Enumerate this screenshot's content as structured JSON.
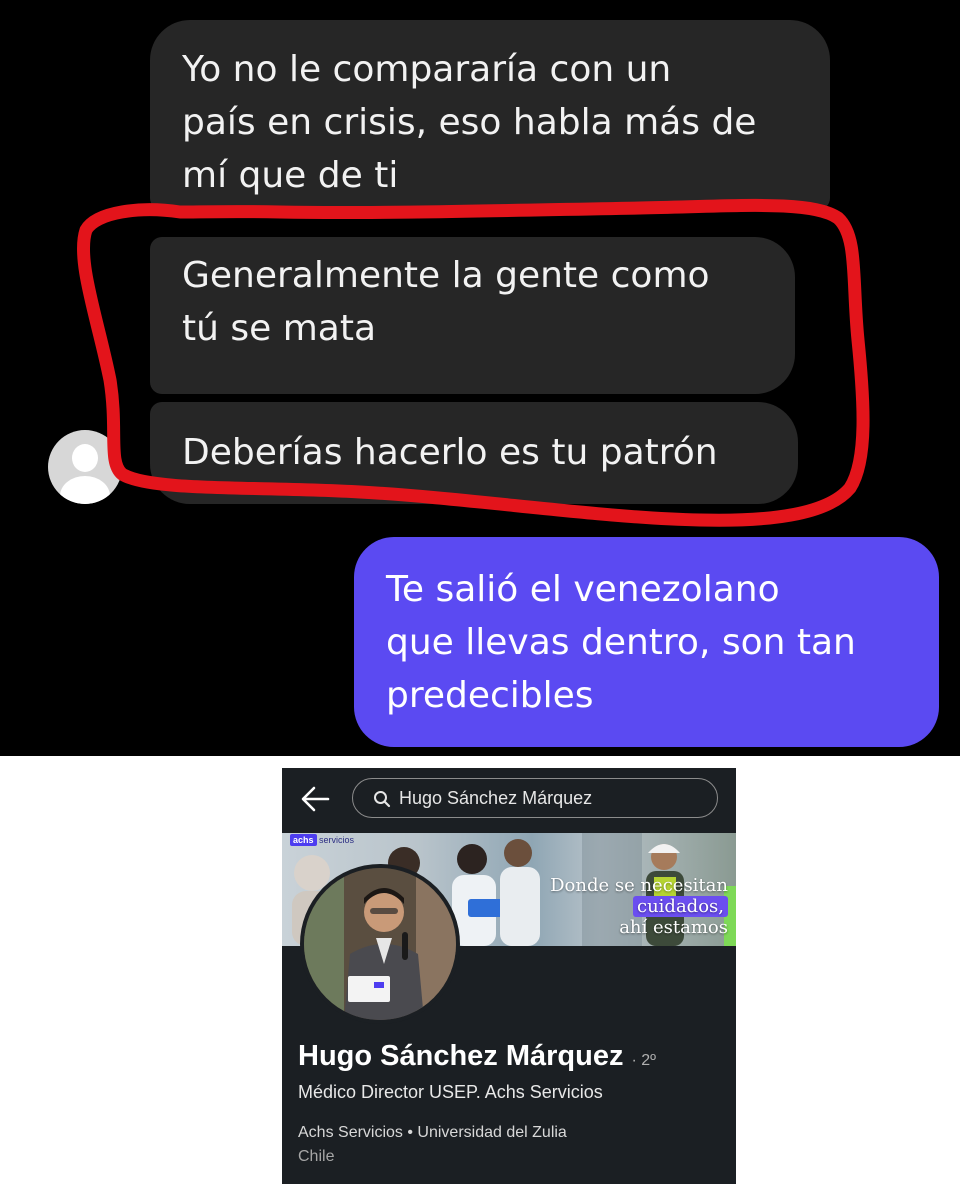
{
  "chat": {
    "messages_received": [
      "Yo no le compararía con un\npaís en crisis, eso habla más de\nmí que de ti",
      "Generalmente la gente como\ntú se mata",
      "Deberías hacerlo es tu patrón"
    ],
    "message_sent": "Te salió el venezolano\nque llevas dentro, son tan\npredecibles",
    "colors": {
      "background": "#000000",
      "received_bubble": "#262626",
      "sent_bubble": "#5b4af2",
      "highlight": "#e3141b"
    }
  },
  "profile": {
    "search": {
      "query": "Hugo Sánchez Márquez"
    },
    "banner": {
      "logo_brand": "achs",
      "logo_suffix": "servicios",
      "tagline_line1": "Donde se necesitan",
      "tagline_line2": "cuidados,",
      "tagline_line3": "ahí estamos"
    },
    "name": "Hugo Sánchez Márquez",
    "connection_degree": "· 2º",
    "headline": "Médico Director USEP. Achs Servicios",
    "organizations": "Achs Servicios • Universidad del Zulia",
    "location": "Chile",
    "icons": {
      "back": "back-arrow-icon",
      "search": "search-icon"
    }
  }
}
